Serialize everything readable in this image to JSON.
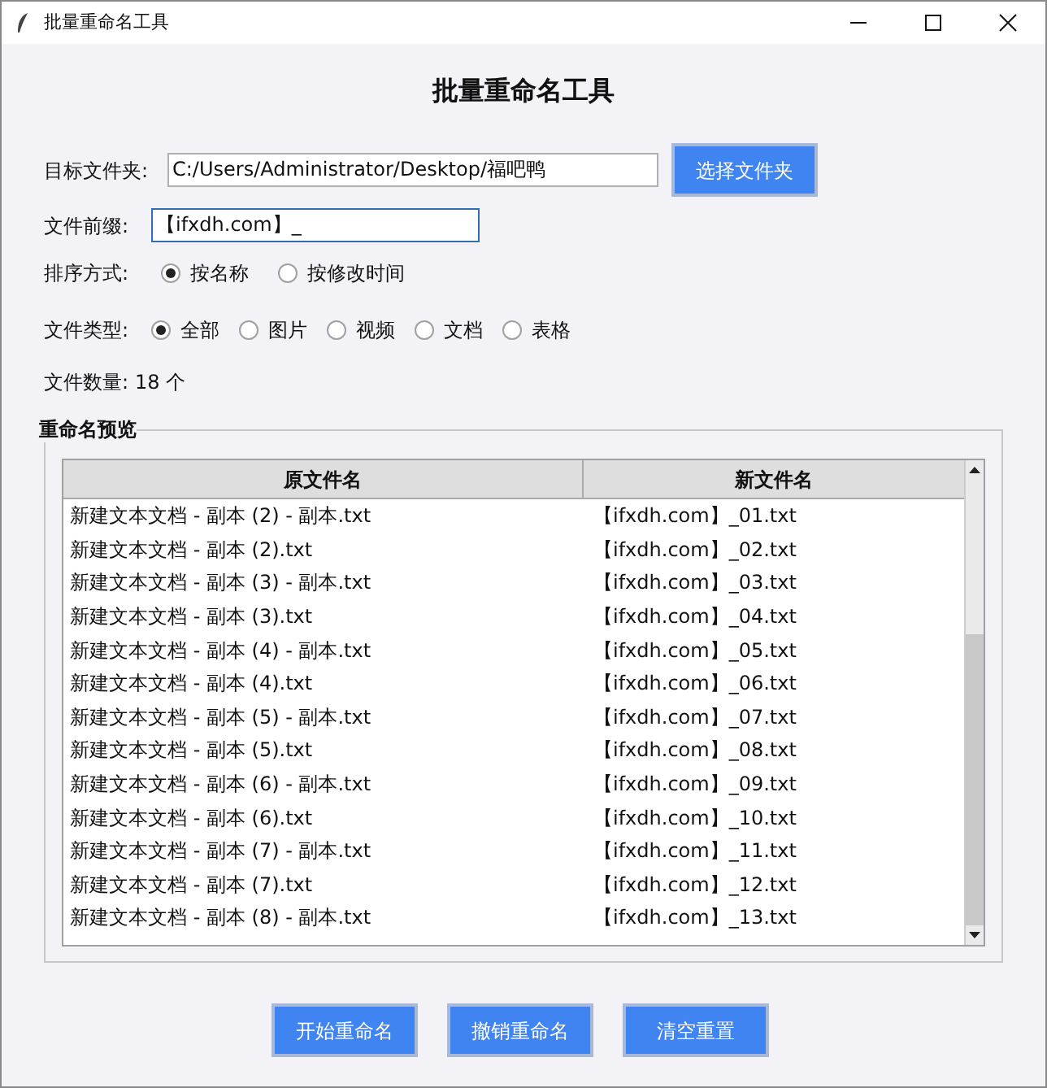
{
  "window": {
    "title": "批量重命名工具"
  },
  "heading": "批量重命名工具",
  "folder": {
    "label": "目标文件夹:",
    "value": "C:/Users/Administrator/Desktop/福吧鸭",
    "button": "选择文件夹"
  },
  "prefix": {
    "label": "文件前缀:",
    "value": "【ifxdh.com】_"
  },
  "sort": {
    "label": "排序方式:",
    "options": [
      {
        "label": "按名称",
        "selected": true
      },
      {
        "label": "按修改时间",
        "selected": false
      }
    ]
  },
  "file_type": {
    "label": "文件类型:",
    "options": [
      {
        "label": "全部",
        "selected": true
      },
      {
        "label": "图片",
        "selected": false
      },
      {
        "label": "视频",
        "selected": false
      },
      {
        "label": "文档",
        "selected": false
      },
      {
        "label": "表格",
        "selected": false
      }
    ]
  },
  "count": {
    "label": "文件数量:",
    "value": "18 个"
  },
  "preview": {
    "title": "重命名预览",
    "columns": [
      "原文件名",
      "新文件名"
    ],
    "rows": [
      [
        "新建文本文档 - 副本 (2) - 副本.txt",
        "【ifxdh.com】_01.txt"
      ],
      [
        "新建文本文档 - 副本 (2).txt",
        "【ifxdh.com】_02.txt"
      ],
      [
        "新建文本文档 - 副本 (3) - 副本.txt",
        "【ifxdh.com】_03.txt"
      ],
      [
        "新建文本文档 - 副本 (3).txt",
        "【ifxdh.com】_04.txt"
      ],
      [
        "新建文本文档 - 副本 (4) - 副本.txt",
        "【ifxdh.com】_05.txt"
      ],
      [
        "新建文本文档 - 副本 (4).txt",
        "【ifxdh.com】_06.txt"
      ],
      [
        "新建文本文档 - 副本 (5) - 副本.txt",
        "【ifxdh.com】_07.txt"
      ],
      [
        "新建文本文档 - 副本 (5).txt",
        "【ifxdh.com】_08.txt"
      ],
      [
        "新建文本文档 - 副本 (6) - 副本.txt",
        "【ifxdh.com】_09.txt"
      ],
      [
        "新建文本文档 - 副本 (6).txt",
        "【ifxdh.com】_10.txt"
      ],
      [
        "新建文本文档 - 副本 (7) - 副本.txt",
        "【ifxdh.com】_11.txt"
      ],
      [
        "新建文本文档 - 副本 (7).txt",
        "【ifxdh.com】_12.txt"
      ],
      [
        "新建文本文档 - 副本 (8) - 副本.txt",
        "【ifxdh.com】_13.txt"
      ]
    ]
  },
  "actions": [
    "开始重命名",
    "撤销重命名",
    "清空重置"
  ]
}
